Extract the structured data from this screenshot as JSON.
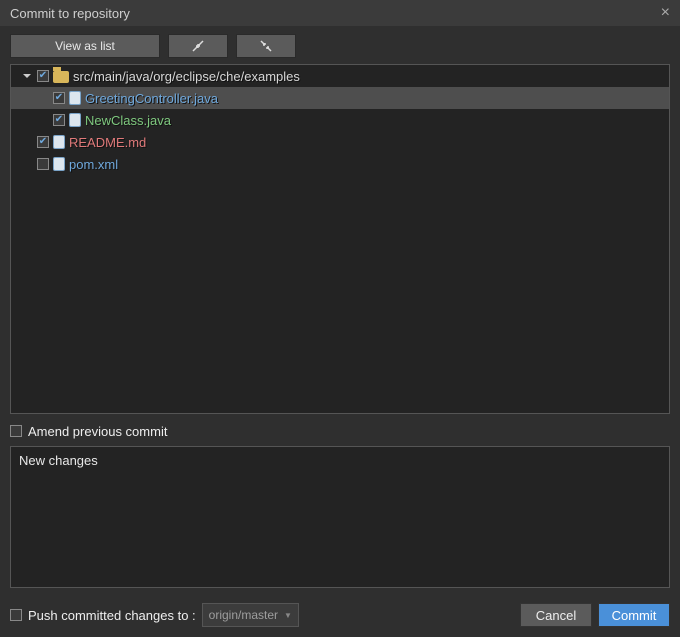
{
  "title": "Commit to repository",
  "toolbar": {
    "view_label": "View as list"
  },
  "tree": {
    "folder_path": "src/main/java/org/eclipse/che/examples",
    "items": [
      {
        "name": "GreetingController.java",
        "status": "modified",
        "checked": true,
        "selected": true
      },
      {
        "name": "NewClass.java",
        "status": "added",
        "checked": true,
        "selected": false
      }
    ],
    "root_items": [
      {
        "name": "README.md",
        "status": "deleted",
        "checked": true
      },
      {
        "name": "pom.xml",
        "status": "unchanged",
        "checked": false
      }
    ]
  },
  "amend": {
    "label": "Amend previous commit",
    "checked": false
  },
  "message": "New changes",
  "footer": {
    "push_label": "Push committed changes to :",
    "push_checked": false,
    "remote": "origin/master",
    "cancel": "Cancel",
    "commit": "Commit"
  }
}
